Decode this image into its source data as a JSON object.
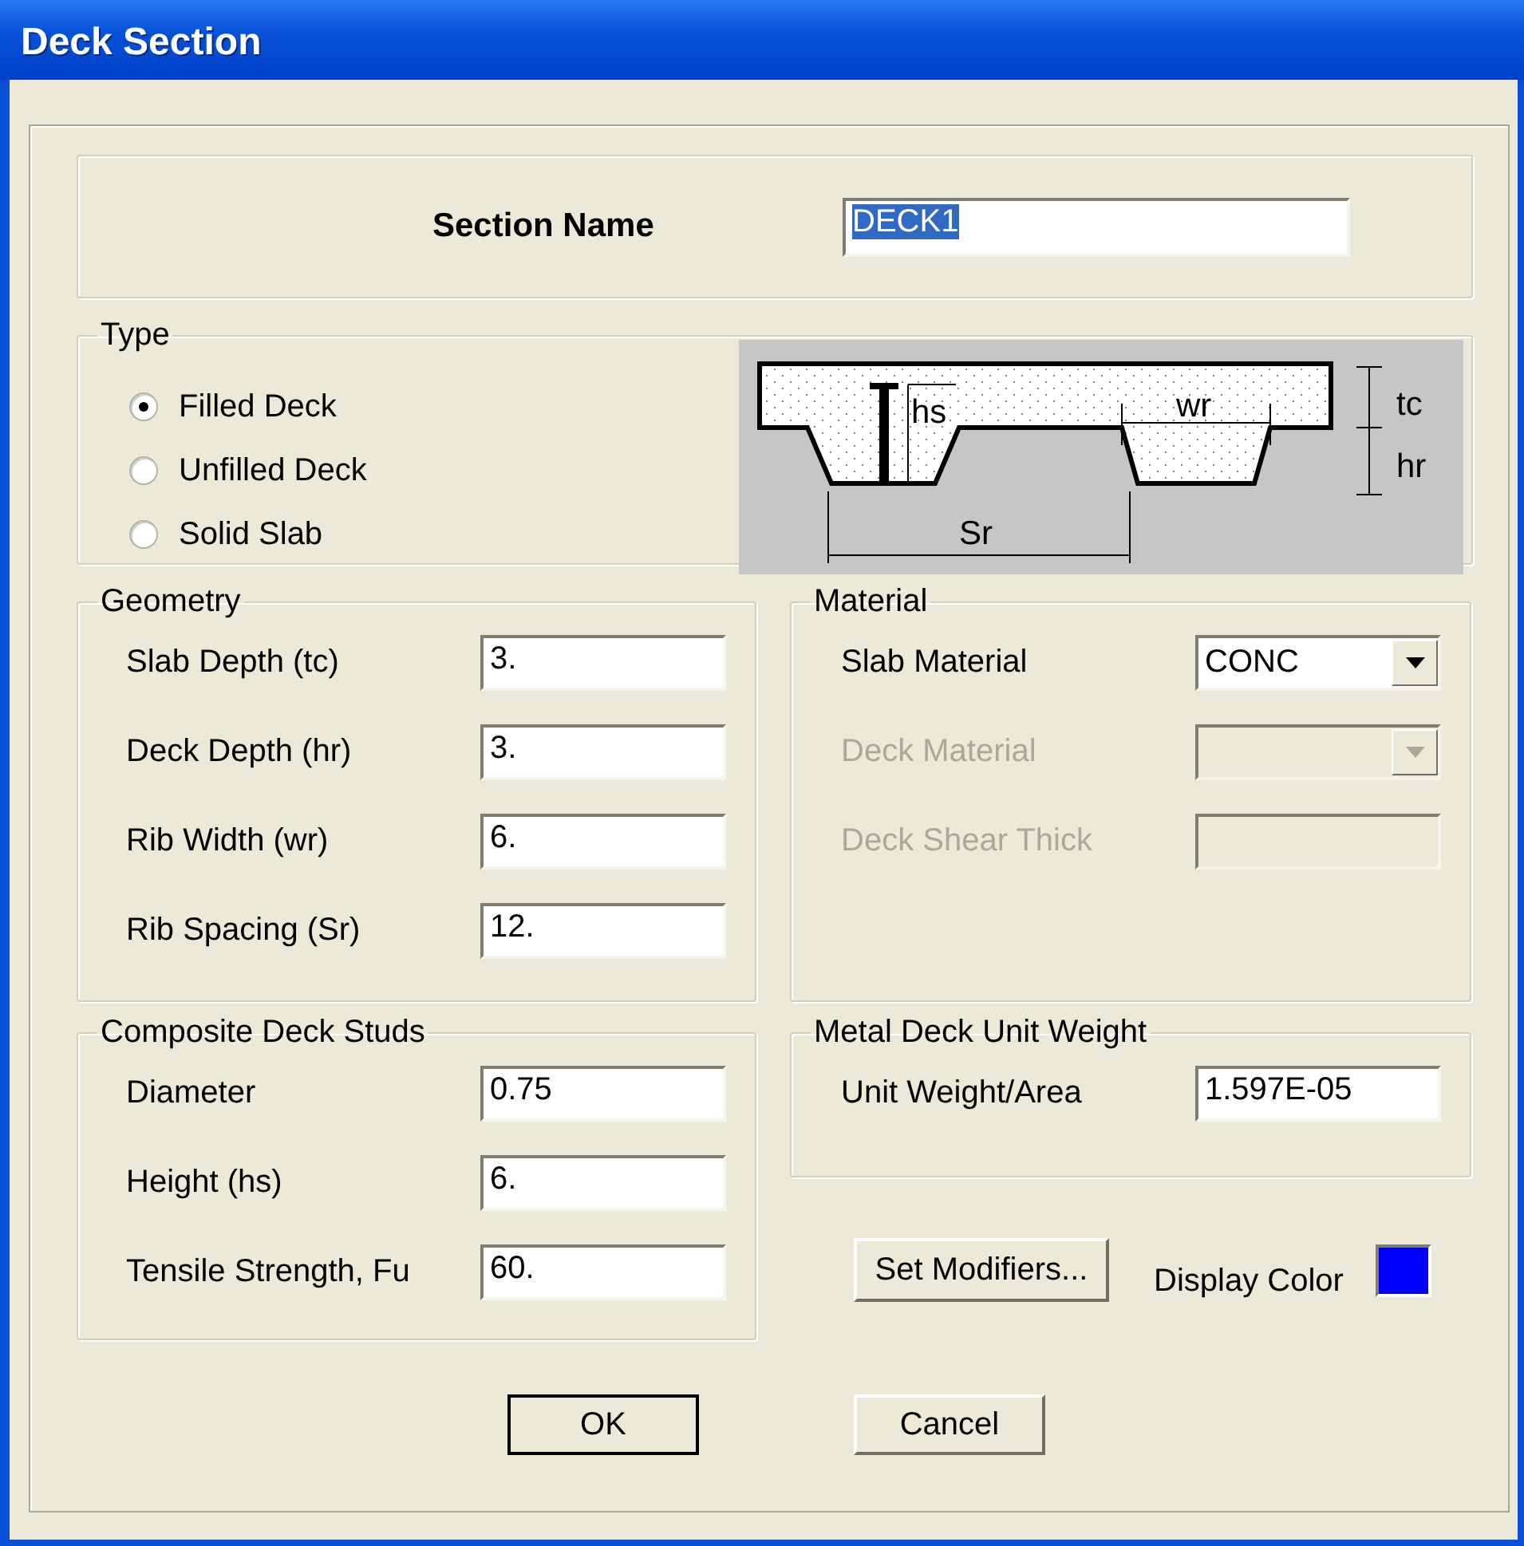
{
  "window": {
    "title": "Deck Section"
  },
  "section_name": {
    "label": "Section Name",
    "value": "DECK1",
    "value_selected": true
  },
  "type": {
    "legend": "Type",
    "options": [
      {
        "label": "Filled Deck",
        "selected": true
      },
      {
        "label": "Unfilled Deck",
        "selected": false
      },
      {
        "label": "Solid Slab",
        "selected": false
      }
    ],
    "diagram": {
      "stud_height": "hs",
      "rib_width": "wr",
      "rib_spacing": "Sr",
      "slab_depth": "tc",
      "deck_depth": "hr"
    }
  },
  "geometry": {
    "legend": "Geometry",
    "rows": [
      {
        "label": "Slab Depth (tc)",
        "value": "3."
      },
      {
        "label": "Deck Depth (hr)",
        "value": "3."
      },
      {
        "label": "Rib Width (wr)",
        "value": "6."
      },
      {
        "label": "Rib Spacing (Sr)",
        "value": "12."
      }
    ]
  },
  "material": {
    "legend": "Material",
    "rows": [
      {
        "label": "Slab Material",
        "kind": "dropdown",
        "value": "CONC",
        "disabled": false
      },
      {
        "label": "Deck Material",
        "kind": "dropdown",
        "disabled": true
      },
      {
        "label": "Deck Shear Thick",
        "kind": "text",
        "disabled": true
      }
    ]
  },
  "studs": {
    "legend": "Composite Deck Studs",
    "rows": [
      {
        "label": "Diameter",
        "value": "0.75"
      },
      {
        "label": "Height (hs)",
        "value": "6."
      },
      {
        "label": "Tensile Strength, Fu",
        "value": "60."
      }
    ]
  },
  "unit_weight": {
    "legend": "Metal Deck Unit Weight",
    "rows": [
      {
        "label": "Unit Weight/Area",
        "value": "1.597E-05"
      }
    ]
  },
  "set_modifiers_button": "Set Modifiers...",
  "display_color": {
    "label": "Display Color",
    "color": "#0000ff"
  },
  "buttons": [
    {
      "label": "OK",
      "default": true
    },
    {
      "label": "Cancel",
      "default": false
    }
  ]
}
